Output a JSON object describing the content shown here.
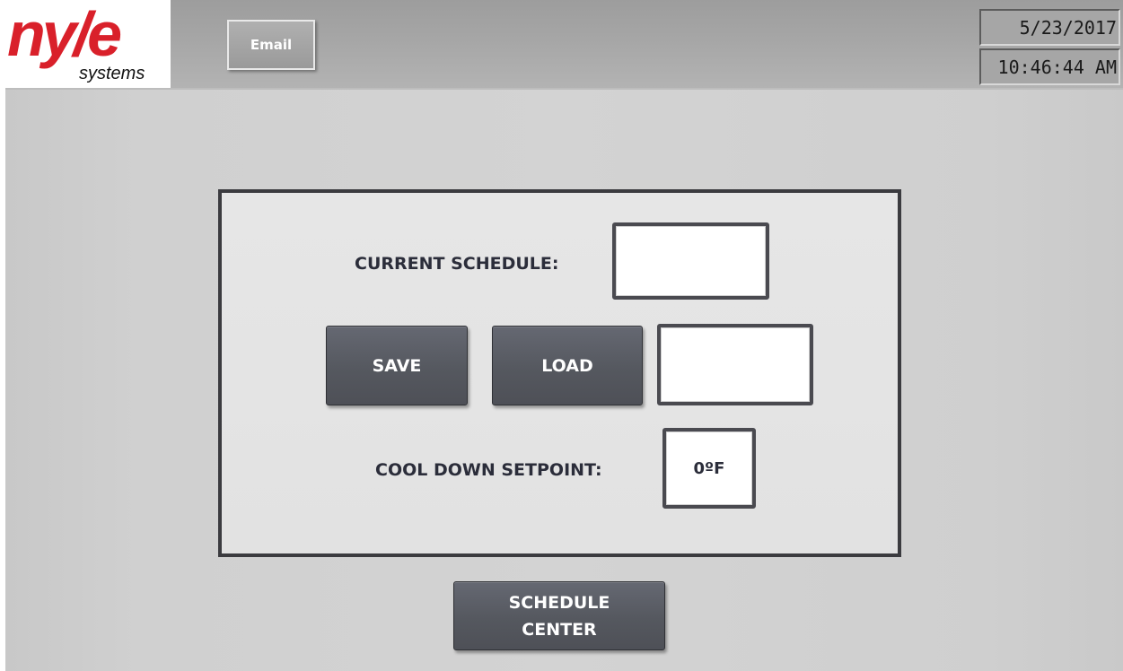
{
  "header": {
    "logo": {
      "main": "ny/e",
      "sub": "systems"
    },
    "email_button": "Email",
    "date": "5/23/2017",
    "time": "10:46:44 AM"
  },
  "panel": {
    "current_schedule_label": "CURRENT SCHEDULE:",
    "current_schedule_value": "",
    "save_button": "SAVE",
    "load_button": "LOAD",
    "load_name_value": "",
    "cool_down_label": "COOL DOWN SETPOINT:",
    "cool_down_value": "0ºF"
  },
  "footer": {
    "schedule_center_button": "SCHEDULE\nCENTER"
  },
  "colors": {
    "brand_red": "#d9202a",
    "button_dark": "#55585f",
    "panel_border": "#3b3b3f"
  }
}
